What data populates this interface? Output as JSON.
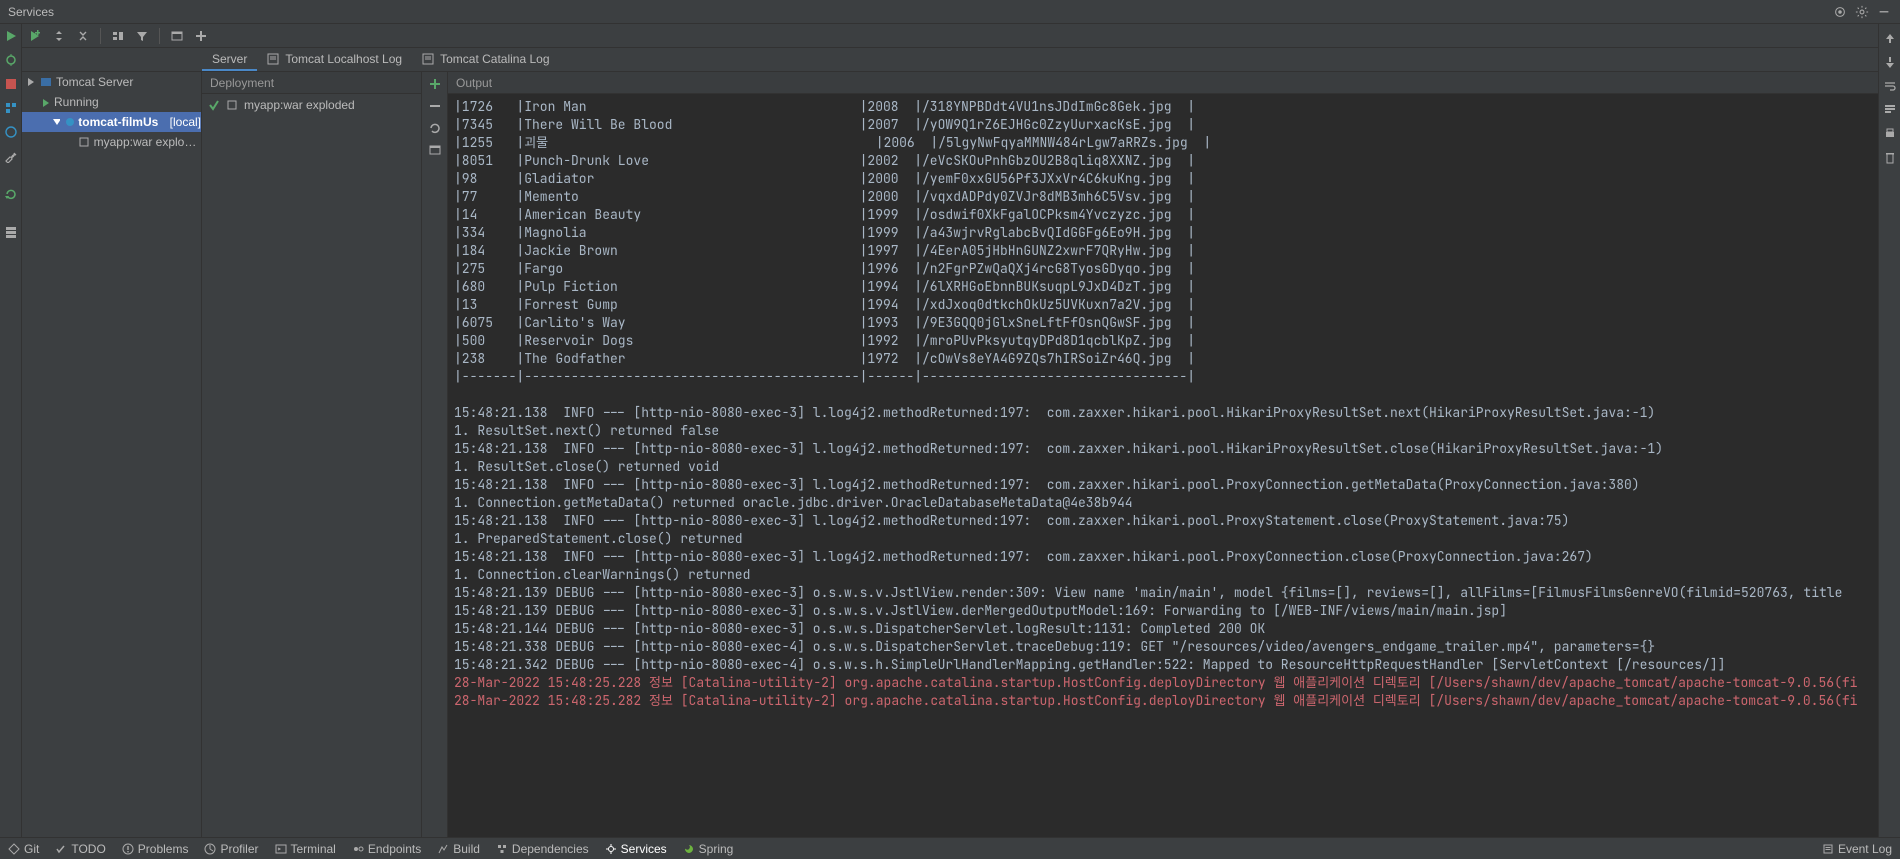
{
  "title": "Services",
  "tabs": {
    "server": "Server",
    "localhost_log": "Tomcat Localhost Log",
    "catalina_log": "Tomcat Catalina Log"
  },
  "panel_headers": {
    "deployment": "Deployment",
    "output": "Output"
  },
  "tree": {
    "root": "Tomcat Server",
    "running": "Running",
    "config": "tomcat-filmUs",
    "config_suffix": "[local]",
    "artifact": "myapp:war exploded"
  },
  "deploy": {
    "artifact": "myapp:war exploded"
  },
  "status_bar": {
    "git": "Git",
    "todo": "TODO",
    "problems": "Problems",
    "profiler": "Profiler",
    "terminal": "Terminal",
    "endpoints": "Endpoints",
    "build": "Build",
    "dependencies": "Dependencies",
    "services": "Services",
    "spring": "Spring",
    "event_log": "Event Log"
  },
  "output_lines": [
    "|1726   |Iron Man                                   |2008  |/318YNPBDdt4VU1nsJDdImGc8Gek.jpg  |",
    "|7345   |There Will Be Blood                        |2007  |/yOW9Q1rZ6EJHGc0ZzyUurxacKsE.jpg  |",
    "|1255   |괴물                                          |2006  |/5lgyNwFqyaMMNW484rLgw7aRRZs.jpg  |",
    "|8051   |Punch-Drunk Love                           |2002  |/eVcSKOuPnhGbzOU2B8qliq8XXNZ.jpg  |",
    "|98     |Gladiator                                  |2000  |/yemF0xxGU56Pf3JXxVr4C6kuKng.jpg  |",
    "|77     |Memento                                    |2000  |/vqxdADPdy0ZVJr8dMB3mh6C5Vsv.jpg  |",
    "|14     |American Beauty                            |1999  |/osdwif0XkFgalOCPksm4Yvczyzc.jpg  |",
    "|334    |Magnolia                                   |1999  |/a43wjrvRglabcBvQIdGGFg6Eo9H.jpg  |",
    "|184    |Jackie Brown                               |1997  |/4EerA05jHbHnGUNZ2xwrF7QRyHw.jpg  |",
    "|275    |Fargo                                      |1996  |/n2FgrPZwQaQXj4rcG8TyosGDyqo.jpg  |",
    "|680    |Pulp Fiction                               |1994  |/6lXRHGoEbnnBUKsuqpL9JxD4DzT.jpg  |",
    "|13     |Forrest Gump                               |1994  |/xdJxoq0dtkchOkUz5UVKuxn7a2V.jpg  |",
    "|6075   |Carlito's Way                              |1993  |/9E3GQQ0jGlxSneLftFfOsnQGwSF.jpg  |",
    "|500    |Reservoir Dogs                             |1992  |/mroPUvPksyutqyDPd8D1qcblKpZ.jpg  |",
    "|238    |The Godfather                              |1972  |/cOwVs8eYA4G9ZQs7hIRSoiZr46Q.jpg  |",
    "|-------|-------------------------------------------|------|----------------------------------|",
    "",
    "15:48:21.138  INFO --- [http-nio-8080-exec-3] l.log4j2.methodReturned:197:  com.zaxxer.hikari.pool.HikariProxyResultSet.next(HikariProxyResultSet.java:-1)",
    "1. ResultSet.next() returned false",
    "15:48:21.138  INFO --- [http-nio-8080-exec-3] l.log4j2.methodReturned:197:  com.zaxxer.hikari.pool.HikariProxyResultSet.close(HikariProxyResultSet.java:-1)",
    "1. ResultSet.close() returned void",
    "15:48:21.138  INFO --- [http-nio-8080-exec-3] l.log4j2.methodReturned:197:  com.zaxxer.hikari.pool.ProxyConnection.getMetaData(ProxyConnection.java:380)",
    "1. Connection.getMetaData() returned oracle.jdbc.driver.OracleDatabaseMetaData@4e38b944",
    "15:48:21.138  INFO --- [http-nio-8080-exec-3] l.log4j2.methodReturned:197:  com.zaxxer.hikari.pool.ProxyStatement.close(ProxyStatement.java:75)",
    "1. PreparedStatement.close() returned",
    "15:48:21.138  INFO --- [http-nio-8080-exec-3] l.log4j2.methodReturned:197:  com.zaxxer.hikari.pool.ProxyConnection.close(ProxyConnection.java:267)",
    "1. Connection.clearWarnings() returned",
    "15:48:21.139 DEBUG --- [http-nio-8080-exec-3] o.s.w.s.v.JstlView.render:309: View name 'main/main', model {films=[], reviews=[], allFilms=[FilmusFilmsGenreVO(filmid=520763, title",
    "15:48:21.139 DEBUG --- [http-nio-8080-exec-3] o.s.w.s.v.JstlView.derMergedOutputModel:169: Forwarding to [/WEB-INF/views/main/main.jsp]",
    "15:48:21.144 DEBUG --- [http-nio-8080-exec-3] o.s.w.s.DispatcherServlet.logResult:1131: Completed 200 OK",
    "15:48:21.338 DEBUG --- [http-nio-8080-exec-4] o.s.w.s.DispatcherServlet.traceDebug:119: GET \"/resources/video/avengers_endgame_trailer.mp4\", parameters={}",
    "15:48:21.342 DEBUG --- [http-nio-8080-exec-4] o.s.w.s.h.SimpleUrlHandlerMapping.getHandler:522: Mapped to ResourceHttpRequestHandler [ServletContext [/resources/]]"
  ],
  "output_red_lines": [
    "28-Mar-2022 15:48:25.228 정보 [Catalina-utility-2] org.apache.catalina.startup.HostConfig.deployDirectory 웹 애플리케이션 디렉토리 [/Users/shawn/dev/apache_tomcat/apache-tomcat-9.0.56(fi",
    "28-Mar-2022 15:48:25.282 정보 [Catalina-utility-2] org.apache.catalina.startup.HostConfig.deployDirectory 웹 애플리케이션 디렉토리 [/Users/shawn/dev/apache_tomcat/apache-tomcat-9.0.56(fi"
  ]
}
